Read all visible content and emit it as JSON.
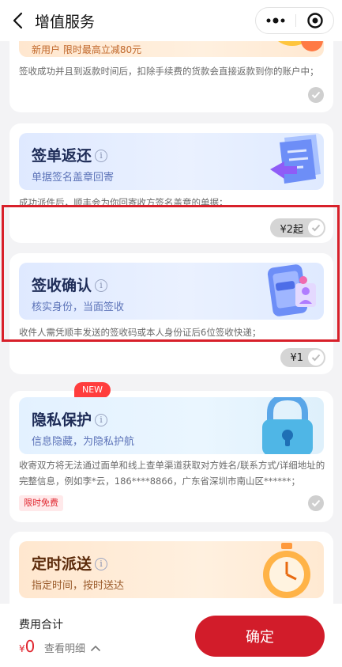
{
  "header": {
    "title": "增值服务"
  },
  "top_card": {
    "banner_cut_text": "新用户 限时最高立减80元",
    "desc": "签收成功并且到返款时间后，扣除手续费的货款会直接返款到你的账户中；"
  },
  "sign_return": {
    "title": "签单返还",
    "subtitle": "单据签名盖章回寄",
    "desc": "成功派件后，顺丰会为你回寄收方签名盖章的单据；",
    "price": "¥2起"
  },
  "sign_confirm": {
    "title": "签收确认",
    "subtitle": "核实身份，当面签收",
    "desc": "收件人需凭顺丰发送的签收码或本人身份证后6位签收快递；",
    "price": "¥1"
  },
  "privacy": {
    "badge": "NEW",
    "title": "隐私保护",
    "subtitle": "信息隐藏，为隐私护航",
    "desc": "收寄双方将无法通过面单和线上查单渠道获取对方姓名/联系方式/详细地址的完整信息，例如李*云，186****8866，广东省深圳市南山区******；",
    "tag": "限时免费"
  },
  "scheduled": {
    "title": "定时派送",
    "subtitle": "指定时间，按时送达"
  },
  "footer": {
    "label": "费用合计",
    "currency": "¥",
    "amount": "0",
    "detail": "查看明细",
    "confirm": "确定"
  },
  "colors": {
    "accent": "#d21c2a",
    "highlight": "#d8202a"
  }
}
